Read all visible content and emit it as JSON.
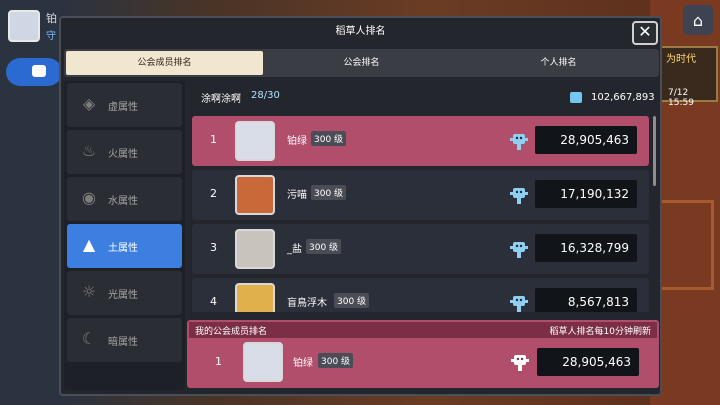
{
  "background": {
    "top_name": "铂",
    "top_sub": "守",
    "event_text": "为时代",
    "event_time": "7/12 15:59"
  },
  "modal": {
    "title": "稻草人排名",
    "close_glyph": "✕",
    "tabs": [
      {
        "label": "公会成员排名",
        "active": true
      },
      {
        "label": "公会排名",
        "active": false
      },
      {
        "label": "个人排名",
        "active": false
      }
    ]
  },
  "attributes": [
    {
      "label": "虚属性",
      "icon": "void-icon",
      "glyph": "◈",
      "active": false
    },
    {
      "label": "火属性",
      "icon": "fire-icon",
      "glyph": "♨",
      "active": false
    },
    {
      "label": "水属性",
      "icon": "water-icon",
      "glyph": "◉",
      "active": false
    },
    {
      "label": "土属性",
      "icon": "earth-icon",
      "glyph": "▲",
      "active": true
    },
    {
      "label": "光属性",
      "icon": "light-icon",
      "glyph": "☼",
      "active": false
    },
    {
      "label": "暗属性",
      "icon": "dark-icon",
      "glyph": "☾",
      "active": false
    }
  ],
  "guild": {
    "name": "涂啊涂啊",
    "count": "28/30",
    "score": "102,667,893"
  },
  "rankings": [
    {
      "rank": "1",
      "name": "铂绿",
      "level": "300 级",
      "score": "28,905,463",
      "mine": true,
      "avatar_color": "#d9dde8"
    },
    {
      "rank": "2",
      "name": "污喵",
      "level": "300 级",
      "score": "17,190,132",
      "mine": false,
      "avatar_color": "#c9693a"
    },
    {
      "rank": "3",
      "name": "_盐",
      "level": "300 级",
      "score": "16,328,799",
      "mine": false,
      "avatar_color": "#c8c3bb"
    },
    {
      "rank": "4",
      "name": "盲鳥浮木",
      "level": "300 级",
      "score": "8,567,813",
      "mine": false,
      "avatar_color": "#e0b04a"
    }
  ],
  "my_ranking": {
    "title": "我的公会成员排名",
    "note": "稻草人排名每10分钟刷新",
    "rank": "1",
    "name": "铂绿",
    "level": "300 级",
    "score": "28,905,463"
  },
  "colors": {
    "accent_blue": "#3d7fe0",
    "highlight_pink": "#b04e6c",
    "tab_active": "#f1e6cf"
  }
}
